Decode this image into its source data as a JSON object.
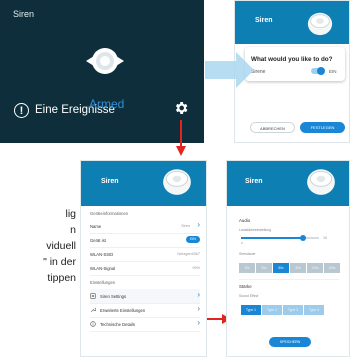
{
  "colors": {
    "dark_bg": "#0e2e3b",
    "brand_blue": "#0d7fb2",
    "accent": "#1a87d6",
    "arrow_red": "#e0251f",
    "arrow_blue": "#a9d7ee"
  },
  "panel_a": {
    "title": "Siren",
    "events_text": "Eine Ereignisse",
    "armed_text": "Armed",
    "icons": [
      "siren-device-icon",
      "exclamation-circle-icon",
      "gear-icon"
    ]
  },
  "panel_b": {
    "title": "Siren",
    "question": "What would you like to do?",
    "switch_label": "Sirene",
    "switch_state": "EIN",
    "cancel_label": "ABBRECHEN",
    "confirm_label": "FESTLEGEN"
  },
  "side_text": [
    "lig",
    "n",
    "viduell",
    "\" in der",
    "tippen"
  ],
  "panel_c": {
    "title": "Siren",
    "section_info": "Geräteinformationen",
    "rows": [
      {
        "label": "Name",
        "value": "Siren"
      },
      {
        "label": "Gerät ist",
        "value": "EIN"
      },
      {
        "label": "WLAN-SSID",
        "value": "Netzgen4567"
      },
      {
        "label": "WLAN-Signal",
        "value": "99%"
      }
    ],
    "section_settings": "Einstellungen",
    "settings_rows": [
      {
        "label": "Siren Settings",
        "icon": "siren-settings-icon"
      },
      {
        "label": "Erweiterte Einstellungen",
        "icon": "wrench-icon"
      },
      {
        "label": "Technische Details",
        "icon": "info-icon"
      }
    ]
  },
  "panel_d": {
    "title": "Siren",
    "audio_label": "Audio",
    "volume_label": "Lautstärkeeinstellung",
    "volume_min": "0",
    "volume_max": "10",
    "volume_level": 0.8,
    "duration_label": "Sirendauer",
    "duration_options": [
      "10s",
      "30s",
      "60s",
      "90s",
      "120s",
      "180s"
    ],
    "duration_selected": "60s",
    "strength_label": "Stärke",
    "sound_effect_label": "Sound Effect",
    "sound_options": [
      "Type 1",
      "Type 2",
      "Type 3",
      "Type 4"
    ],
    "sound_selected": "Type 1",
    "save_label": "SPEICHERN"
  }
}
